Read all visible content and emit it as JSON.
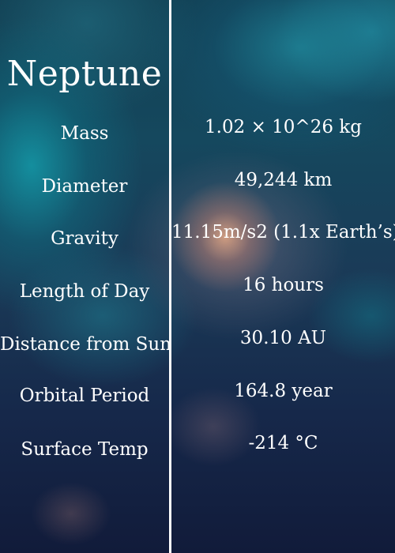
{
  "planet": {
    "name": "Neptune"
  },
  "facts": [
    {
      "label": "Mass",
      "value": "1.02 × 10^26 kg"
    },
    {
      "label": "Diameter",
      "value": "49,244 km"
    },
    {
      "label": "Gravity",
      "value": "11.15m/s2 (1.1x Earth’s)"
    },
    {
      "label": "Length of Day",
      "value": "16 hours"
    },
    {
      "label": "Distance from Sun",
      "value": "30.10 AU"
    },
    {
      "label": "Orbital Period",
      "value": "164.8 year"
    },
    {
      "label": "Surface Temp",
      "value": "-214 °C"
    }
  ]
}
